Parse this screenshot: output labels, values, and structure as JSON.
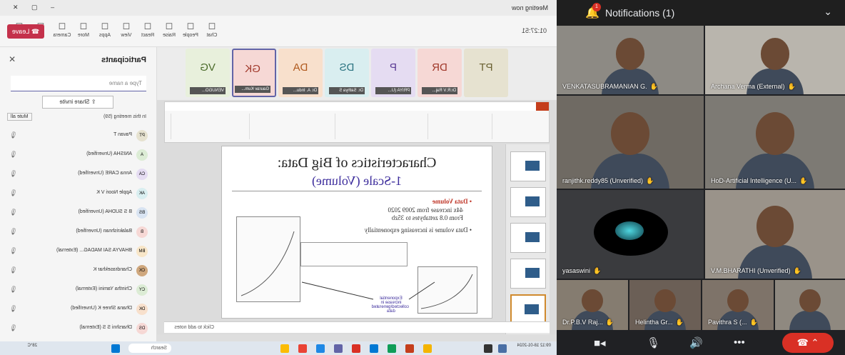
{
  "teams": {
    "window_title": "Meeting now",
    "timer": "01:27:51",
    "toolbar": [
      {
        "icon": "chat-icon",
        "label": "Chat"
      },
      {
        "icon": "people-icon",
        "label": "People"
      },
      {
        "icon": "raise-icon",
        "label": "Raise"
      },
      {
        "icon": "react-icon",
        "label": "React"
      },
      {
        "icon": "view-icon",
        "label": "View"
      },
      {
        "icon": "apps-icon",
        "label": "Apps"
      },
      {
        "icon": "more-icon",
        "label": "More"
      },
      {
        "icon": "camera-icon",
        "label": "Camera"
      },
      {
        "icon": "mic-icon",
        "label": "Mic"
      },
      {
        "icon": "share-icon",
        "label": "Share"
      }
    ],
    "leave_label": "Leave",
    "avatar_strip": [
      {
        "initials": "VG",
        "name": "VENUGO...",
        "bg": "#e8f0dc",
        "fg": "#4b6b2a"
      },
      {
        "initials": "GK",
        "name": "Gaurav Kum...",
        "bg": "#f6d8d5",
        "fg": "#a0382a"
      },
      {
        "initials": "DA",
        "name": "Dr. A. Indu...",
        "bg": "#f8e0cc",
        "fg": "#b05a1e"
      },
      {
        "initials": "DS",
        "name": "Dr. Sathya S",
        "bg": "#d9eef0",
        "fg": "#2a7380"
      },
      {
        "initials": "P",
        "name": "PRIYA (U...",
        "bg": "#e5dcf2",
        "fg": "#5b3b95"
      },
      {
        "initials": "DR",
        "name": "Dr.R.V Raj...",
        "bg": "#f6d8d5",
        "fg": "#a0382a"
      },
      {
        "initials": "PT",
        "name": "",
        "bg": "#e6e2d0",
        "fg": "#6b6233"
      }
    ],
    "slide": {
      "title": "Characteristics of Big Data:",
      "subtitle": "1-Scale (Volume)",
      "bullet1_head": "Data Volume",
      "bullet1_a": "44x increase from 2009 2020",
      "bullet1_b": "From 0.8 zettabytes to 35zb",
      "bullet2": "Data volume is increasing exponentially",
      "annotation": "Exponential increase in collected/generated data",
      "notes_placeholder": "Click to add notes"
    },
    "participants": {
      "title": "Participants",
      "search_placeholder": "Type a name",
      "share_invite": "Share invite",
      "section": "In this meeting (59)",
      "mute_all": "Mute all",
      "people": [
        {
          "initials": "PT",
          "name": "Pavan T",
          "bg": "#e6e2d0"
        },
        {
          "initials": "A",
          "name": "ANISHA (Unverified)",
          "bg": "#dcecd5"
        },
        {
          "initials": "CA",
          "name": "Anna CARE (Unverified)",
          "bg": "#e5dcf2"
        },
        {
          "initials": "AK",
          "name": "Apple Noori V K",
          "bg": "#d9eef0"
        },
        {
          "initials": "BS",
          "name": "B S SUDHA (Unverified)",
          "bg": "#d9e4f2"
        },
        {
          "initials": "B",
          "name": "Balakrishnan (Unverified)",
          "bg": "#f6d8d5"
        },
        {
          "initials": "BM",
          "name": "BHAVYA SAI MADAG... (External)",
          "bg": "#f8e6c8"
        },
        {
          "initials": "CK",
          "name": "Chandrasekhar K",
          "bg": "#cfa77d"
        },
        {
          "initials": "CY",
          "name": "Chintha Yamini (External)",
          "bg": "#dcecd5"
        },
        {
          "initials": "DK",
          "name": "Dhana Shree K (Unverified)",
          "bg": "#f8e0cc"
        },
        {
          "initials": "DS",
          "name": "Dharshni S S (External)",
          "bg": "#f6d8d5"
        }
      ]
    },
    "taskbar": {
      "time": "09:12",
      "date": "18-01-2024",
      "search": "Search",
      "weather": "28°C"
    }
  },
  "meet": {
    "notification": "Notifications (1)",
    "notification_count": "1",
    "tiles": [
      {
        "name": "VENKATASUBRAMANIAN G.",
        "bg": "#8d8a84"
      },
      {
        "name": "Archana Verma (External)",
        "bg": "#b9b5ad"
      },
      {
        "name": "ranjithk.reddy85 (Unverified)",
        "bg": "#6f6a63"
      },
      {
        "name": "HoD-Artificial Intelligence (U...",
        "bg": "#7d7a74"
      },
      {
        "name": "yasaswini",
        "bg": "#3a3b3e"
      },
      {
        "name": "V.M.BHARATHI (Unverified)",
        "bg": "#9a938a"
      },
      {
        "name": "Dr.P.B.V Raj...",
        "bg": "#857c70"
      },
      {
        "name": "Helintha Gr...",
        "bg": "#6b5f56"
      },
      {
        "name": "Pavithra S (...",
        "bg": "#7e7369"
      },
      {
        "name": "",
        "bg": "#8f8980"
      }
    ],
    "hand_symbol": "✋"
  }
}
